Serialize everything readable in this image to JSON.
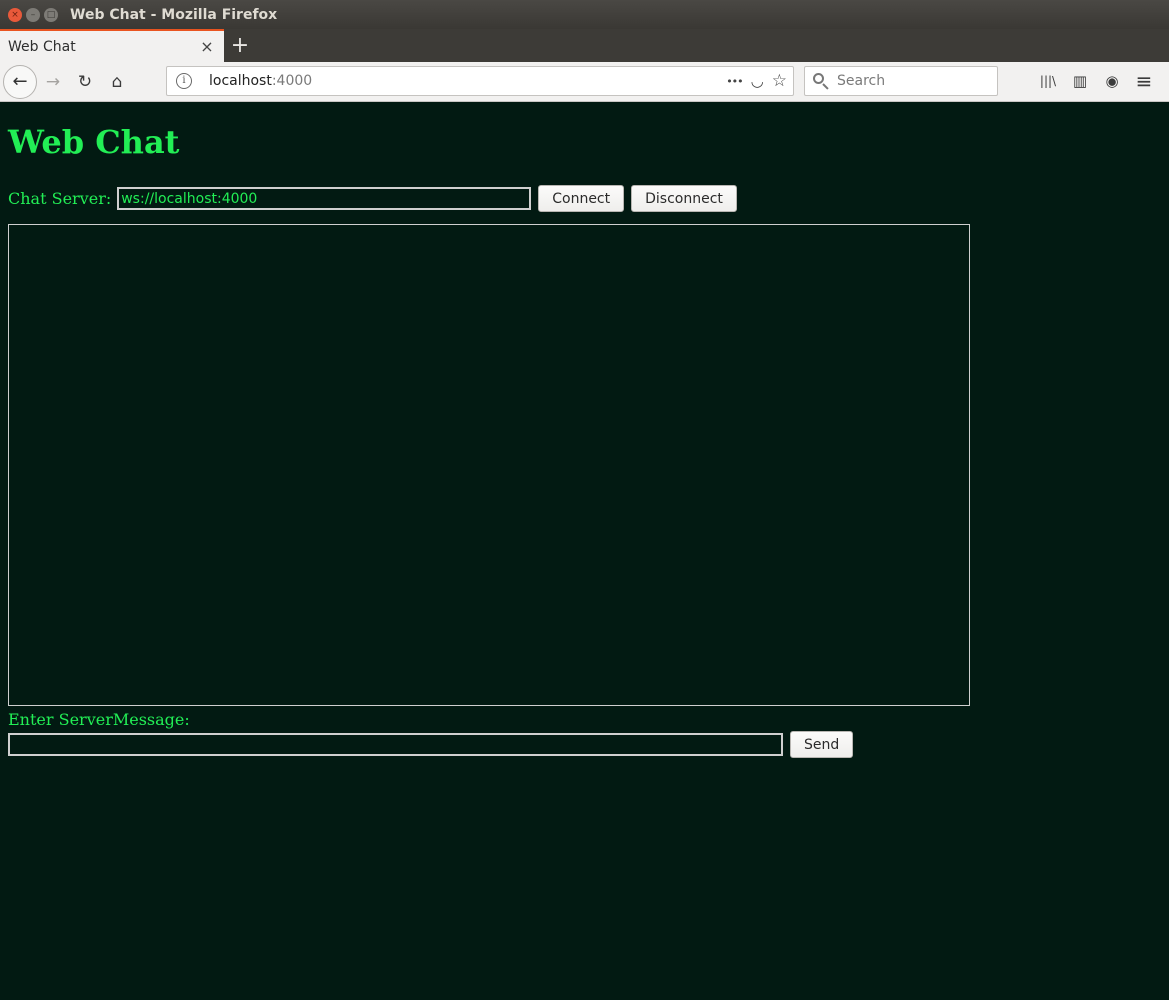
{
  "window": {
    "title": "Web Chat - Mozilla Firefox",
    "close_glyph": "×",
    "minimize_glyph": "–",
    "maximize_glyph": "□"
  },
  "tabs": [
    {
      "title": "Web Chat",
      "close_glyph": "×",
      "active": true
    }
  ],
  "new_tab_glyph": "+",
  "nav": {
    "back_glyph": "←",
    "forward_glyph": "→",
    "reload_glyph": "↻",
    "home_glyph": "⌂",
    "url_host": "localhost",
    "url_port": ":4000",
    "info_glyph": "i",
    "more_glyph": "•••",
    "pocket_glyph": "◡",
    "bookmark_glyph": "☆",
    "search_placeholder": "Search",
    "library_glyph": "|||\\",
    "sidebar_glyph": "▥",
    "account_glyph": "◉",
    "menu_glyph": "≡"
  },
  "page": {
    "title": "Web Chat",
    "server_label": "Chat Server:",
    "server_value": "ws://localhost:4000",
    "connect_label": "Connect",
    "disconnect_label": "Disconnect",
    "message_label": "Enter ServerMessage:",
    "message_value": "",
    "send_label": "Send"
  },
  "colors": {
    "page_background": "#021a12",
    "text_accent": "#22ee55",
    "tab_accent": "#e95420"
  }
}
